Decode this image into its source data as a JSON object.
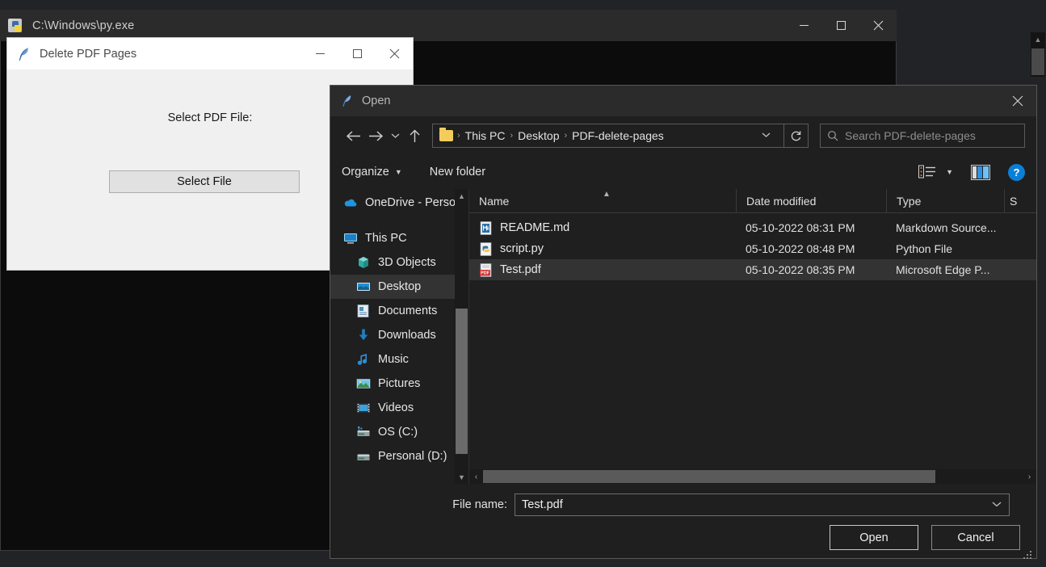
{
  "console_window": {
    "title": "C:\\Windows\\py.exe",
    "icon": "python-exe-icon",
    "controls": {
      "minimize": "minimize-icon",
      "maximize": "maximize-icon",
      "close": "close-icon"
    }
  },
  "tk_window": {
    "title": "Delete PDF Pages",
    "icon": "feather-icon",
    "label": "Select PDF File:",
    "button": "Select File",
    "controls": {
      "minimize": "minimize-icon",
      "maximize": "maximize-icon",
      "close": "close-icon"
    }
  },
  "open_dialog": {
    "title": "Open",
    "icon": "feather-icon",
    "close": "close-icon",
    "address": {
      "back": "back-arrow-icon",
      "forward": "forward-arrow-icon",
      "recent": "chevron-down-icon",
      "up": "up-arrow-icon",
      "folder_icon": "folder-icon",
      "crumbs": [
        "This PC",
        "Desktop",
        "PDF-delete-pages"
      ],
      "separator": "›",
      "dropdown": "chevron-down-icon",
      "refresh": "refresh-icon"
    },
    "search": {
      "icon": "search-icon",
      "placeholder": "Search PDF-delete-pages"
    },
    "toolbar": {
      "organize": "Organize",
      "new_folder": "New folder",
      "view_icon": "view-options-icon",
      "view_caret": "chevron-down-icon",
      "preview_pane_icon": "preview-pane-icon",
      "help": "?"
    },
    "nav_pane": {
      "items": [
        {
          "label": "OneDrive - Person",
          "icon": "onedrive-icon",
          "indent": 0,
          "selected": false
        },
        {
          "label": "This PC",
          "icon": "this-pc-icon",
          "indent": 0,
          "selected": false
        },
        {
          "label": "3D Objects",
          "icon": "3d-objects-icon",
          "indent": 1,
          "selected": false
        },
        {
          "label": "Desktop",
          "icon": "desktop-icon",
          "indent": 1,
          "selected": true
        },
        {
          "label": "Documents",
          "icon": "documents-icon",
          "indent": 1,
          "selected": false
        },
        {
          "label": "Downloads",
          "icon": "downloads-icon",
          "indent": 1,
          "selected": false
        },
        {
          "label": "Music",
          "icon": "music-icon",
          "indent": 1,
          "selected": false
        },
        {
          "label": "Pictures",
          "icon": "pictures-icon",
          "indent": 1,
          "selected": false
        },
        {
          "label": "Videos",
          "icon": "videos-icon",
          "indent": 1,
          "selected": false
        },
        {
          "label": "OS (C:)",
          "icon": "os-drive-icon",
          "indent": 1,
          "selected": false
        },
        {
          "label": "Personal (D:)",
          "icon": "drive-icon",
          "indent": 1,
          "selected": false
        }
      ],
      "scroll_up": "chevron-up-icon",
      "scroll_down": "chevron-down-icon"
    },
    "file_list": {
      "columns": [
        "Name",
        "Date modified",
        "Type",
        "S"
      ],
      "sort_column": "Name",
      "sort_caret": "sort-ascending-icon",
      "rows": [
        {
          "name": "README.md",
          "date": "05-10-2022 08:31 PM",
          "type": "Markdown Source...",
          "icon": "markdown-file-icon",
          "selected": false
        },
        {
          "name": "script.py",
          "date": "05-10-2022 08:48 PM",
          "type": "Python File",
          "icon": "python-file-icon",
          "selected": false
        },
        {
          "name": "Test.pdf",
          "date": "05-10-2022 08:35 PM",
          "type": "Microsoft Edge P...",
          "icon": "pdf-file-icon",
          "selected": true
        }
      ],
      "scroll_left": "‹",
      "scroll_right": "›"
    },
    "footer": {
      "file_name_label": "File name:",
      "file_name_value": "Test.pdf",
      "file_name_caret": "chevron-down-icon",
      "open_button": "Open",
      "cancel_button": "Cancel",
      "resize_grip": "resize-grip-icon"
    }
  },
  "colors": {
    "dark_chrome": "#1f1f1f",
    "titlebar": "#2b2b2b",
    "selection": "#333333",
    "accent_blue": "#0a7fd6",
    "pdf_red": "#d42f2f",
    "folder_yellow": "#f2cd5c",
    "light_window": "#f0f0f0"
  }
}
